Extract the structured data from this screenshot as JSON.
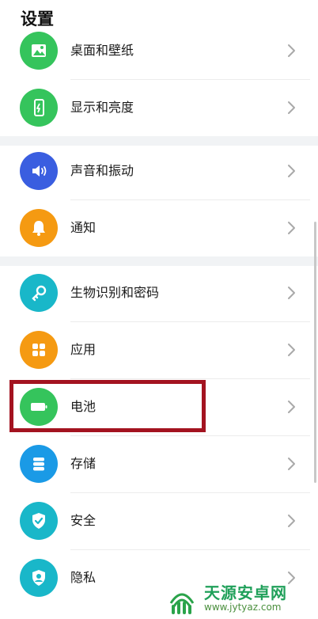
{
  "header": {
    "title": "设置"
  },
  "items": [
    {
      "label": "桌面和壁纸",
      "icon": "wallpaper-icon",
      "color": "#35c45c"
    },
    {
      "label": "显示和亮度",
      "icon": "phone-brightness-icon",
      "color": "#35c45c"
    },
    {
      "label": "声音和振动",
      "icon": "speaker-icon",
      "color": "#3a5ee0"
    },
    {
      "label": "通知",
      "icon": "bell-icon",
      "color": "#f59a12"
    },
    {
      "label": "生物识别和密码",
      "icon": "key-icon",
      "color": "#19b7c9"
    },
    {
      "label": "应用",
      "icon": "apps-grid-icon",
      "color": "#f59a12"
    },
    {
      "label": "电池",
      "icon": "battery-icon",
      "color": "#35c45c"
    },
    {
      "label": "存储",
      "icon": "storage-icon",
      "color": "#1a9ae6"
    },
    {
      "label": "安全",
      "icon": "shield-check-icon",
      "color": "#19b7c9"
    },
    {
      "label": "隐私",
      "icon": "privacy-shield-icon",
      "color": "#19b7c9"
    }
  ],
  "highlight": {
    "target": "电池",
    "color": "#a31320"
  },
  "watermark": {
    "name": "天源安卓网",
    "url": "www.jytyaz.com"
  }
}
